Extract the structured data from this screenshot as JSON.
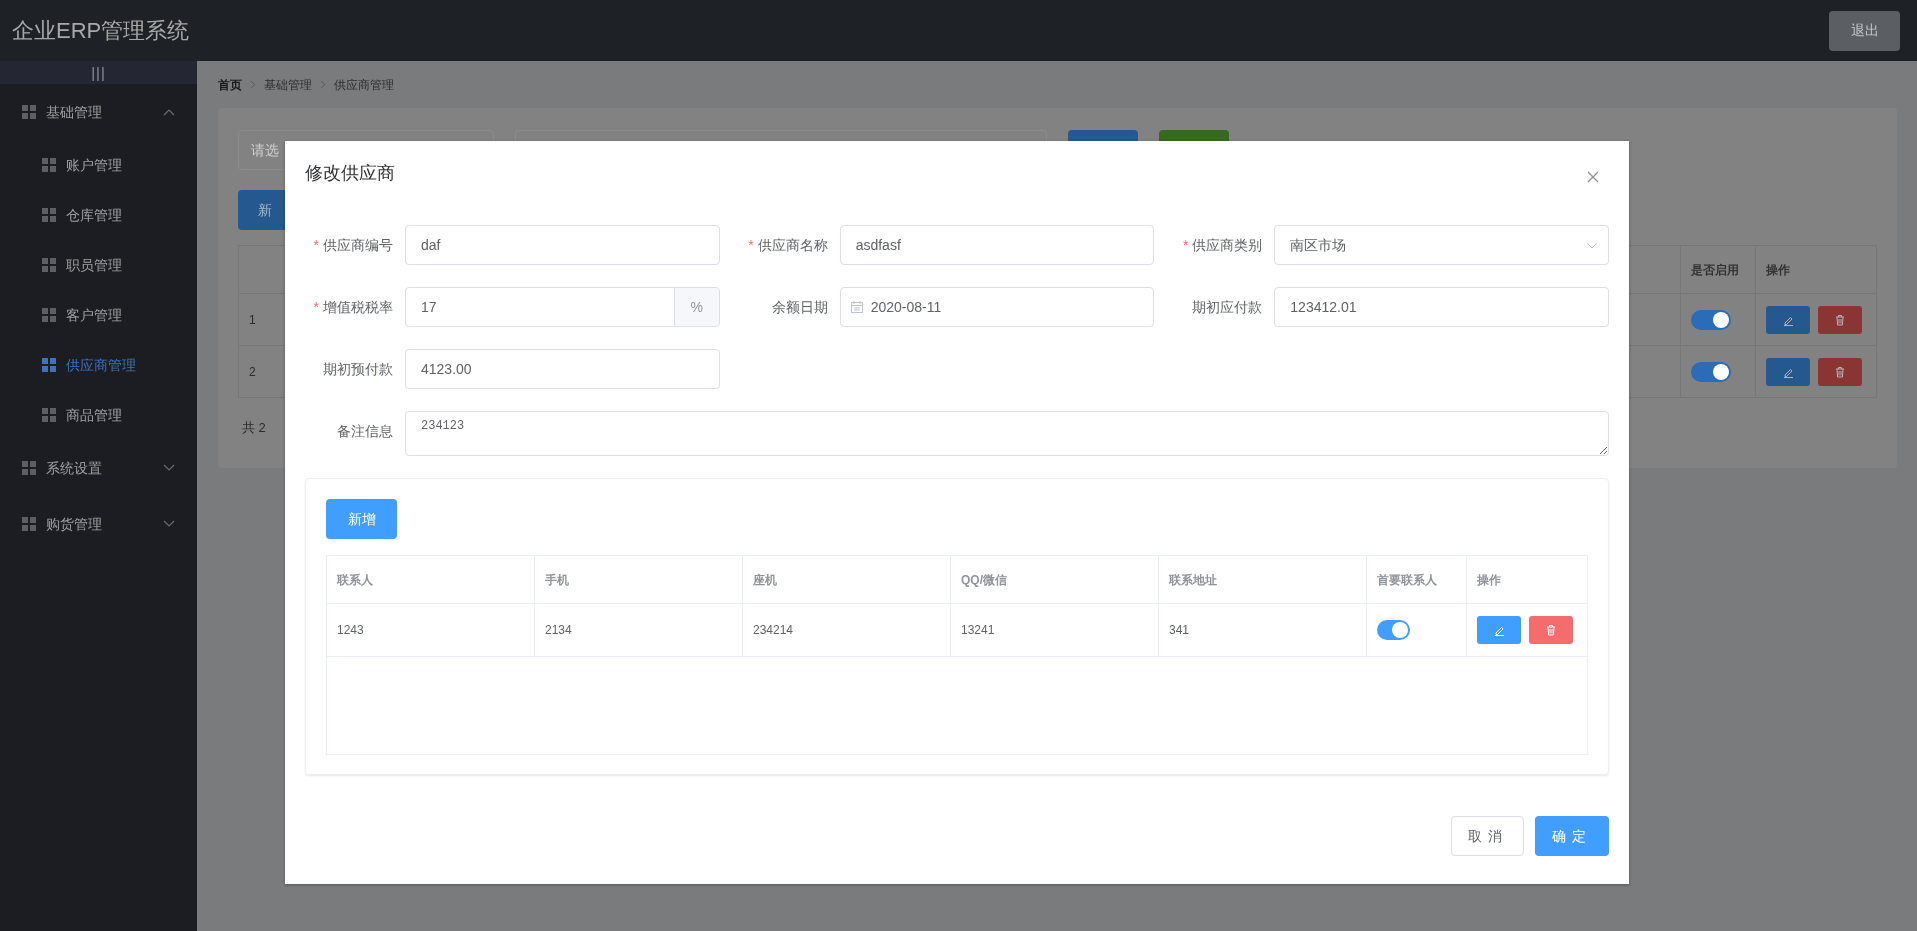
{
  "header": {
    "title": "企业ERP管理系统",
    "logout": "退出"
  },
  "sidebar": {
    "toggle": "|||",
    "items": [
      {
        "label": "基础管理",
        "expanded": true,
        "selected": false,
        "children": [
          {
            "label": "账户管理",
            "selected": false
          },
          {
            "label": "仓库管理",
            "selected": false
          },
          {
            "label": "职员管理",
            "selected": false
          },
          {
            "label": "客户管理",
            "selected": false
          },
          {
            "label": "供应商管理",
            "selected": true
          },
          {
            "label": "商品管理",
            "selected": false
          }
        ]
      },
      {
        "label": "系统设置",
        "expanded": false,
        "selected": false
      },
      {
        "label": "购货管理",
        "expanded": false,
        "selected": false
      }
    ]
  },
  "breadcrumb": [
    "首页",
    "基础管理",
    "供应商管理"
  ],
  "page": {
    "filter_placeholder": "请选",
    "add_button": "新",
    "table": {
      "columns": [
        "是否启用",
        "操作"
      ],
      "rows": [
        {
          "index": "1",
          "enabled": true
        },
        {
          "index": "2",
          "enabled": true
        }
      ]
    },
    "total": "共 2"
  },
  "dialog": {
    "title": "修改供应商",
    "fields": [
      {
        "kind": "text",
        "label": "供应商编号",
        "required_mark": "*",
        "value": "daf"
      },
      {
        "kind": "text",
        "label": "供应商名称",
        "required_mark": "*",
        "value": "asdfasf"
      },
      {
        "kind": "select",
        "label": "供应商类别",
        "required_mark": "*",
        "value": "南区市场"
      },
      {
        "kind": "append",
        "label": "增值税税率",
        "required_mark": "*",
        "value": "17",
        "suffix": "%"
      },
      {
        "kind": "date",
        "label": "余额日期",
        "value": "2020-08-11"
      },
      {
        "kind": "text",
        "label": "期初应付款",
        "value": "123412.01"
      },
      {
        "kind": "text",
        "label": "期初预付款",
        "value": "4123.00"
      }
    ],
    "remark": {
      "label": "备注信息",
      "value": "234123"
    },
    "contacts": {
      "add_button": "新增",
      "columns": [
        "联系人",
        "手机",
        "座机",
        "QQ/微信",
        "联系地址",
        "首要联系人",
        "操作"
      ],
      "rows": [
        {
          "cells": [
            "1243",
            "2134",
            "234214",
            "13241",
            "341"
          ],
          "primary": true
        }
      ]
    },
    "buttons": {
      "cancel": "取消",
      "ok": "确定"
    }
  }
}
